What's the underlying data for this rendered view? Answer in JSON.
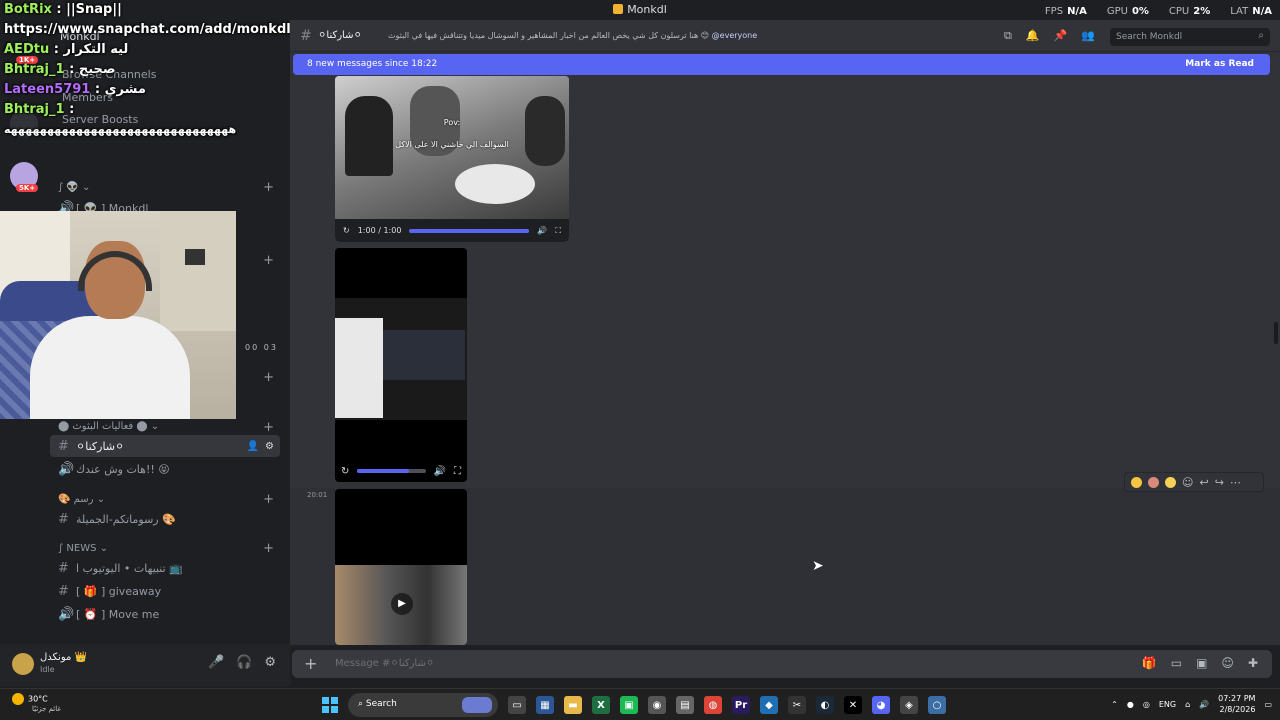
{
  "app": {
    "title": "Monkdl"
  },
  "perf": [
    {
      "label": "FPS",
      "value": "N/A"
    },
    {
      "label": "GPU",
      "value": "0%"
    },
    {
      "label": "CPU",
      "value": "2%"
    },
    {
      "label": "LAT",
      "value": "N/A"
    }
  ],
  "overlay": {
    "lines": [
      {
        "user": "BotRix",
        "sep": " : ",
        "text": "||Snap||"
      },
      {
        "user": "",
        "sep": "",
        "text": "https://www.snapchat.com/add/monkdl"
      },
      {
        "user": "AEDtu",
        "sep": " : ",
        "text": "ليه التكرار"
      },
      {
        "user": "Bhtraj_1",
        "sep": " : ",
        "text": "صحيح"
      },
      {
        "user": "Lateen5791",
        "sep": " : ",
        "text": "مشري"
      },
      {
        "user": "Bhtraj_1",
        "sep": " : ",
        "text": ""
      },
      {
        "user": "",
        "sep": "",
        "text": "هههههههههههههههههههههههههههههههه"
      }
    ]
  },
  "server": {
    "name": "Monkdl",
    "links": [
      "Browse Channels",
      "Members",
      "Server Boosts"
    ],
    "badges": [
      "1K+",
      "5K+"
    ]
  },
  "sidebar": {
    "categories": [
      {
        "label": "∫ 👽 ⌄"
      },
      {
        "label": "⬤ فعاليات البثوث ⬤ ⌄"
      },
      {
        "label": "🎨 رسم ⌄"
      },
      {
        "label": "∫ NEWS ⌄"
      }
    ],
    "channels": [
      {
        "icon": "🔊",
        "label": "[ 👽 ] Monkdl"
      },
      {
        "icon": "#",
        "label": "⚪شاركنا⚪",
        "active": true
      },
      {
        "icon": "🔊",
        "label": "هات وش عندك!! 😝"
      },
      {
        "icon": "#",
        "label": "رسوماتكم-الجميلة 🎨"
      },
      {
        "icon": "#",
        "label": "تنبيهات • اليوتيوب ا 📺"
      },
      {
        "icon": "#",
        "label": "[ 🎁 ] giveaway"
      },
      {
        "icon": "🔊",
        "label": "[ ⏰ ] Move me"
      }
    ],
    "timer": "00 03"
  },
  "user": {
    "name": "مونكدل 👑",
    "status": "Idle"
  },
  "channel": {
    "name": "⚪شاركنا⚪",
    "topic": "هنا ترسلون كل شي يخص العالم من اخبار المشاهير و السوشال ميديا وتتناقش فيها في البثوث 😊",
    "mention": "@everyone",
    "search_placeholder": "Search Monkdl"
  },
  "new_messages": {
    "text": "8 new messages since 18:22",
    "action": "Mark as Read"
  },
  "video1": {
    "caption_top": "Pov:",
    "caption": "السوالف الي خاشني الا على الاكل",
    "time": "1:00 / 1:00",
    "progress": 1.0
  },
  "video2": {
    "progress": 0.75
  },
  "message": {
    "timestamp": "20:01"
  },
  "composer": {
    "placeholder": "Message #⚪شاركنا⚪"
  },
  "taskbar": {
    "weather_temp": "30°C",
    "weather_desc": "غائم جزئيًا",
    "search": "Search",
    "lang": "ENG",
    "time": "07:27 PM",
    "date": "2/8/2026"
  },
  "colors": {
    "accent": "#5865f2",
    "bg": "#313338",
    "sidebar": "#1e1f22"
  }
}
